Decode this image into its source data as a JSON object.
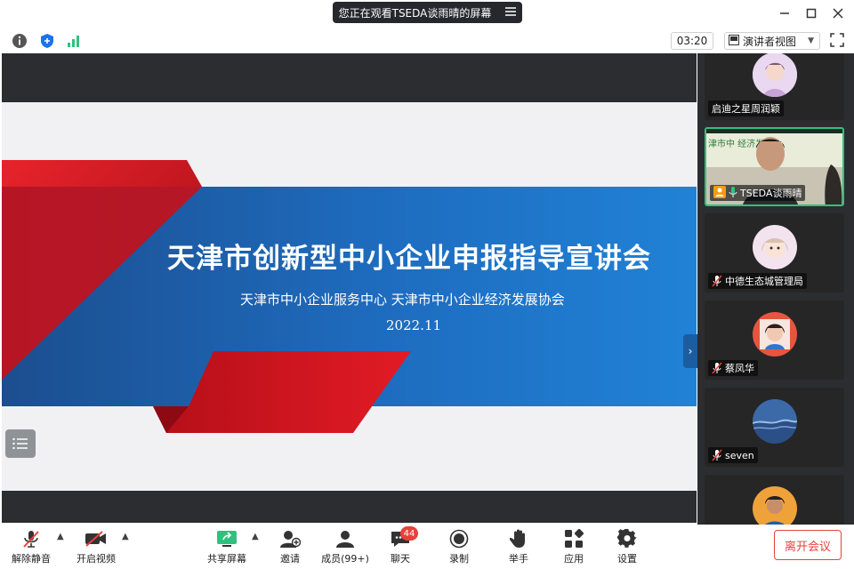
{
  "window": {
    "share_banner": "您正在观看TSEDA谈雨晴的屏幕",
    "minimize_icon": "minimize-icon",
    "maximize_icon": "maximize-icon",
    "close_icon": "close-icon"
  },
  "toolbar": {
    "timer": "03:20",
    "view_mode": "演讲者视图"
  },
  "slide": {
    "title": "天津市创新型中小企业申报指导宣讲会",
    "subtitle": "天津市中小企业服务中心  天津市中小企业经济发展协会",
    "date": "2022.11"
  },
  "participants": [
    {
      "name": "启迪之星周润颖",
      "muted": false,
      "video": false
    },
    {
      "name": "TSEDA谈雨晴",
      "muted": false,
      "video": true,
      "active": true
    },
    {
      "name": "中德生态城管理局",
      "muted": true,
      "video": false
    },
    {
      "name": "蔡凤华",
      "muted": true,
      "video": false
    },
    {
      "name": "seven",
      "muted": true,
      "video": false
    },
    {
      "name": "",
      "muted": false,
      "video": false
    }
  ],
  "controls": {
    "unmute": "解除静音",
    "start_video": "开启视频",
    "share_screen": "共享屏幕",
    "invite": "邀请",
    "members": "成员(99+)",
    "chat": "聊天",
    "chat_badge": "44",
    "record": "录制",
    "raise_hand": "举手",
    "apps": "应用",
    "settings": "设置",
    "leave": "离开会议"
  },
  "colors": {
    "accent_blue": "#1b5da0",
    "slide_red": "#d8121f",
    "active_border": "#2ec27e",
    "leave_red": "#e8413c"
  }
}
